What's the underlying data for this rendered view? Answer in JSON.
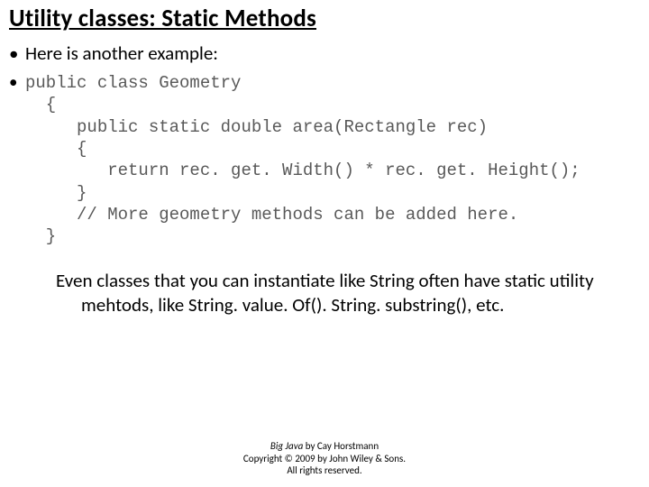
{
  "title": "Utility classes: Static Methods",
  "intro": "Here is another example:",
  "code": "public class Geometry\n  {\n     public static double area(Rectangle rec)\n     {\n        return rec. get. Width() * rec. get. Height();\n     }\n     // More geometry methods can be added here.\n  }",
  "paragraph": "Even classes that you can instantiate like String often have static utility mehtods, like String. value. Of().  String. substring(), etc.",
  "footer": {
    "book": "Big Java",
    "author": " by Cay Horstmann",
    "copyright": "Copyright © 2009 by John Wiley & Sons.",
    "rights": "All rights reserved."
  }
}
